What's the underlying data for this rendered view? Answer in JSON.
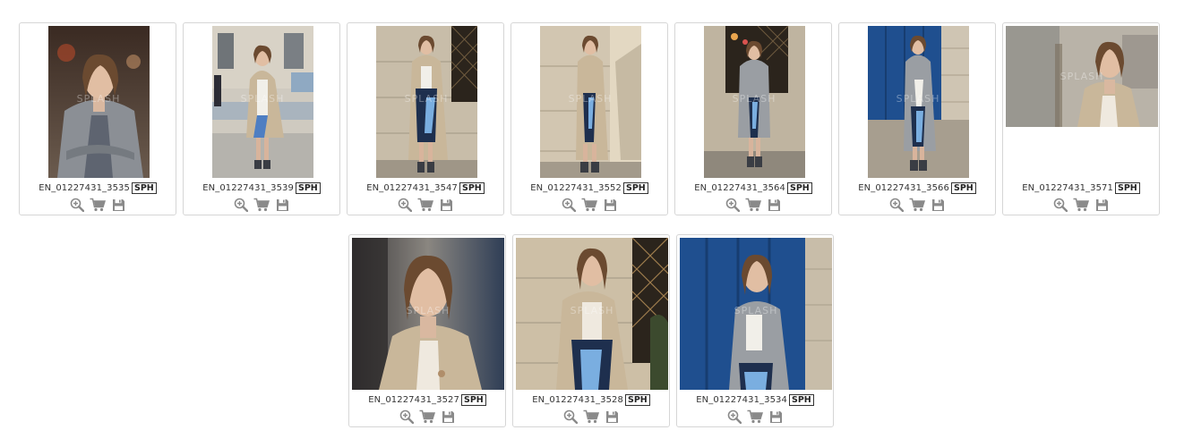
{
  "photos": [
    {
      "id": "EN_01227431_3535",
      "badge": "SPH",
      "watermark": "SPLASH"
    },
    {
      "id": "EN_01227431_3539",
      "badge": "SPH",
      "watermark": "SPLASH"
    },
    {
      "id": "EN_01227431_3547",
      "badge": "SPH",
      "watermark": "SPLASH"
    },
    {
      "id": "EN_01227431_3552",
      "badge": "SPH",
      "watermark": "SPLASH"
    },
    {
      "id": "EN_01227431_3564",
      "badge": "SPH",
      "watermark": "SPLASH"
    },
    {
      "id": "EN_01227431_3566",
      "badge": "SPH",
      "watermark": "SPLASH"
    },
    {
      "id": "EN_01227431_3571",
      "badge": "SPH",
      "watermark": "SPLASH"
    },
    {
      "id": "EN_01227431_3527",
      "badge": "SPH",
      "watermark": "SPLASH"
    },
    {
      "id": "EN_01227431_3528",
      "badge": "SPH",
      "watermark": "SPLASH"
    },
    {
      "id": "EN_01227431_3534",
      "badge": "SPH",
      "watermark": "SPLASH"
    }
  ],
  "icons": {
    "zoom": "zoom-in-icon",
    "cart": "shopping-cart-icon",
    "save": "save-disk-icon"
  },
  "colors": {
    "icon": "#8a8a8a",
    "border": "#d6d6d6",
    "text": "#333333",
    "blue_door": "#1f4f8f",
    "coat": "#c9b79a",
    "stone": "#c8bda9"
  }
}
